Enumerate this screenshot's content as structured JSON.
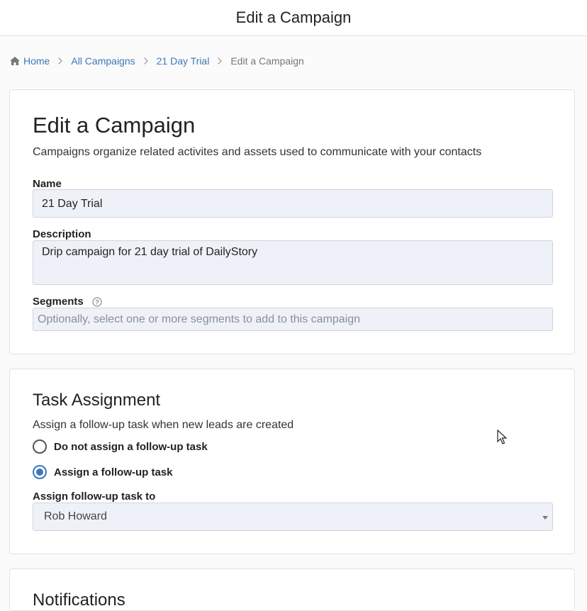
{
  "header": {
    "title": "Edit a Campaign"
  },
  "breadcrumb": {
    "items": [
      "Home",
      "All Campaigns",
      "21 Day Trial"
    ],
    "current": "Edit a Campaign"
  },
  "campaign_card": {
    "title": "Edit a Campaign",
    "subtitle": "Campaigns organize related activites and assets used to communicate with your contacts",
    "name_label": "Name",
    "name_value": "21 Day Trial",
    "description_label": "Description",
    "description_value": "Drip campaign for 21 day trial of DailyStory",
    "segments_label": "Segments",
    "segments_placeholder": "Optionally, select one or more segments to add to this campaign"
  },
  "task_card": {
    "title": "Task Assignment",
    "subtitle": "Assign a follow-up task when new leads are created",
    "option_none": "Do not assign a follow-up task",
    "option_assign": "Assign a follow-up task",
    "selected_option": "Assign a follow-up task",
    "assign_to_label": "Assign follow-up task to",
    "assign_to_value": "Rob Howard"
  },
  "notifications_card": {
    "title": "Notifications"
  },
  "colors": {
    "accent": "#3b78b7",
    "field_bg": "#eef2f8"
  }
}
